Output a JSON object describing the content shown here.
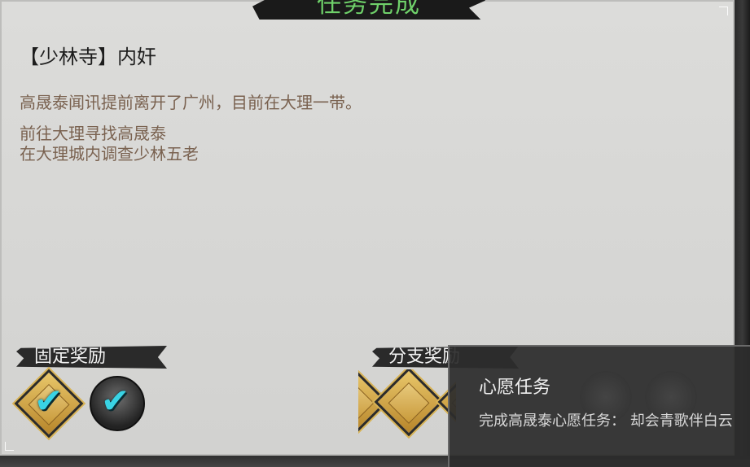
{
  "banner": {
    "title": "任务完成"
  },
  "quest": {
    "title": "【少林寺】内奸",
    "description": "高晟泰闻讯提前离开了广州，目前在大理一带。",
    "objectives": [
      "前往大理寻找高晟泰",
      "在大理城内调查少林五老"
    ]
  },
  "rewards": {
    "fixed_label": "固定奖励",
    "branch_label": "分支奖励",
    "fixed_items": [
      {
        "icon": "gold-book-item-icon",
        "completed": true
      },
      {
        "icon": "character-portrait-icon",
        "completed": true
      }
    ],
    "branch_items": [
      {
        "icon": "gold-scroll-item-icon"
      },
      {
        "icon": "gold-scroll-item-icon"
      },
      {
        "icon": "gold-scroll-item-icon"
      }
    ]
  },
  "tooltip": {
    "title": "心愿任务",
    "body": "完成高晟泰心愿任务： 却会青歌伴白云"
  },
  "colors": {
    "banner_text": "#6fd16a",
    "check": "#39d3e4",
    "description_text": "#7a6250"
  }
}
